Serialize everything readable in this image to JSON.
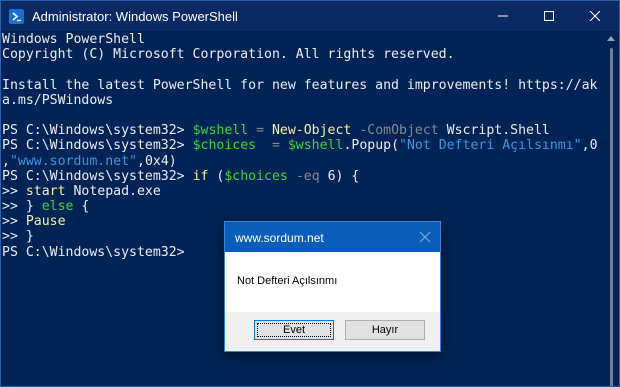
{
  "window": {
    "title": "Administrator: Windows PowerShell",
    "controls": {
      "minimize": "minimize-icon",
      "maximize": "maximize-icon",
      "close": "close-icon"
    }
  },
  "console": {
    "lines": [
      [
        {
          "t": "Windows PowerShell",
          "c": ""
        }
      ],
      [
        {
          "t": "Copyright (C) Microsoft Corporation. All rights reserved.",
          "c": ""
        }
      ],
      [
        {
          "t": "",
          "c": ""
        }
      ],
      [
        {
          "t": "Install the latest PowerShell for new features and improvements! https://ak",
          "c": ""
        }
      ],
      [
        {
          "t": "a.ms/PSWindows",
          "c": ""
        }
      ],
      [
        {
          "t": "",
          "c": ""
        }
      ],
      [
        {
          "t": "PS C:\\Windows\\system32> ",
          "c": ""
        },
        {
          "t": "$wshell",
          "c": "c-var"
        },
        {
          "t": " = ",
          "c": "c-op"
        },
        {
          "t": "New-Object",
          "c": "c-cmd"
        },
        {
          "t": " -ComObject",
          "c": "c-param"
        },
        {
          "t": " Wscript.Shell",
          "c": ""
        }
      ],
      [
        {
          "t": "PS C:\\Windows\\system32> ",
          "c": ""
        },
        {
          "t": "$choices",
          "c": "c-var"
        },
        {
          "t": "  = ",
          "c": "c-op"
        },
        {
          "t": "$wshell",
          "c": "c-var"
        },
        {
          "t": ".Popup(",
          "c": ""
        },
        {
          "t": "\"Not Defteri Açılsınmı\"",
          "c": "c-str"
        },
        {
          "t": ",0",
          "c": ""
        }
      ],
      [
        {
          "t": ",",
          "c": ""
        },
        {
          "t": "\"www.sordum.net\"",
          "c": "c-str"
        },
        {
          "t": ",0x4)",
          "c": ""
        }
      ],
      [
        {
          "t": "PS C:\\Windows\\system32> ",
          "c": ""
        },
        {
          "t": "if",
          "c": "c-cmd"
        },
        {
          "t": " (",
          "c": ""
        },
        {
          "t": "$choices",
          "c": "c-var"
        },
        {
          "t": " -eq",
          "c": "c-param"
        },
        {
          "t": " 6) {",
          "c": ""
        }
      ],
      [
        {
          "t": ">> ",
          "c": ""
        },
        {
          "t": "start",
          "c": "c-cmd"
        },
        {
          "t": " Notepad.exe",
          "c": ""
        }
      ],
      [
        {
          "t": ">> } ",
          "c": ""
        },
        {
          "t": "else",
          "c": "c-kw"
        },
        {
          "t": " {",
          "c": ""
        }
      ],
      [
        {
          "t": ">> ",
          "c": ""
        },
        {
          "t": "Pause",
          "c": "c-cmd"
        }
      ],
      [
        {
          "t": ">> }",
          "c": ""
        }
      ],
      [
        {
          "t": "PS C:\\Windows\\system32>",
          "c": ""
        }
      ]
    ]
  },
  "dialog": {
    "title": "www.sordum.net",
    "message": "Not Defteri Açılsınmı",
    "buttons": {
      "yes": "Evet",
      "no": "Hayır"
    }
  }
}
